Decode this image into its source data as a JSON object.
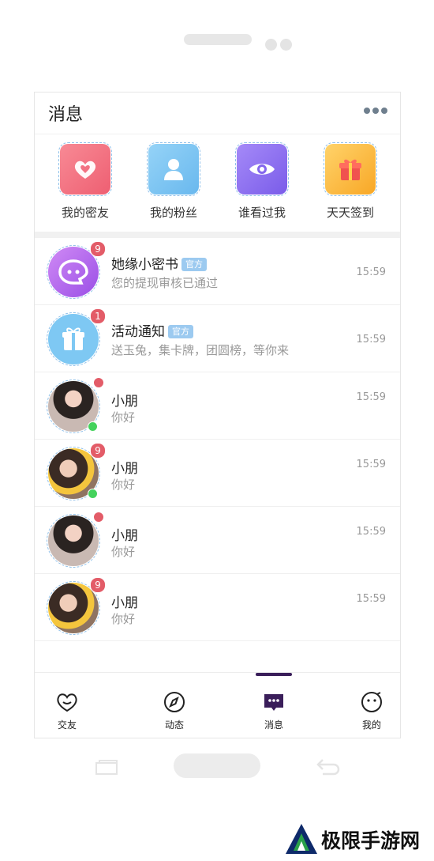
{
  "header": {
    "title": "消息"
  },
  "quick_actions": [
    {
      "label": "我的密友",
      "icon": "heart-chat-icon",
      "color": "#f16b7b"
    },
    {
      "label": "我的粉丝",
      "icon": "user-icon",
      "color": "#7cc5f2"
    },
    {
      "label": "谁看过我",
      "icon": "eye-icon",
      "color": "#8a6cf0"
    },
    {
      "label": "天天签到",
      "icon": "gift-box-icon",
      "color": "#fbb63a"
    }
  ],
  "conversations": [
    {
      "name": "她缘小密书",
      "tag": "官方",
      "preview": "您的提现审核已通过",
      "time": "15:59",
      "badge": "9"
    },
    {
      "name": "活动通知",
      "tag": "官方",
      "preview": "送玉兔，集卡牌，团圆榜，等你来",
      "time": "15:59",
      "badge": "1"
    },
    {
      "name": "小朋",
      "preview": "你好",
      "time": "15:59"
    },
    {
      "name": "小朋",
      "preview": "你好",
      "time": "15:59",
      "badge": "9"
    },
    {
      "name": "小朋",
      "preview": "你好",
      "time": "15:59"
    },
    {
      "name": "小朋",
      "preview": "你好",
      "time": "15:59",
      "badge": "9"
    }
  ],
  "tabbar": [
    {
      "label": "交友",
      "icon": "heart-face-icon"
    },
    {
      "label": "动态",
      "icon": "compass-icon"
    },
    {
      "label": "消息",
      "icon": "message-icon",
      "active": true
    },
    {
      "label": "我的",
      "icon": "smiley-icon"
    }
  ],
  "watermark": "极限手游网",
  "colors": {
    "badge": "#e35c68",
    "online": "#44d25c",
    "active_tab": "#3a1e5a",
    "official_tag": "#9ccaf0"
  }
}
